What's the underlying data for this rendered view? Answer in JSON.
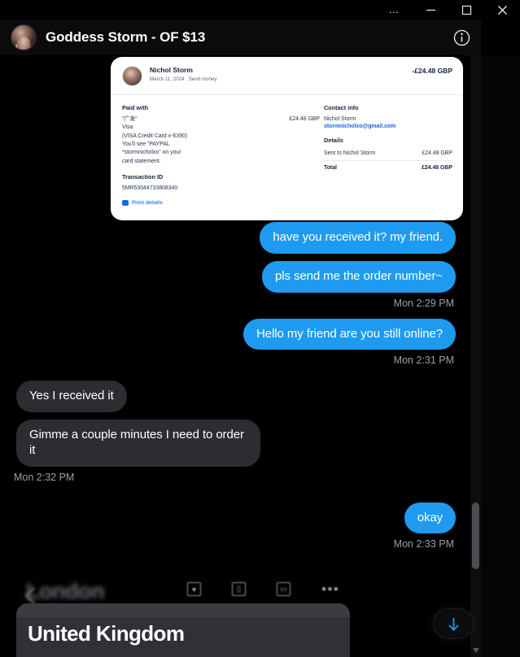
{
  "window": {
    "controls": [
      {
        "name": "more-options",
        "glyph": "…"
      },
      {
        "name": "minimize",
        "glyph": "—"
      },
      {
        "name": "maximize",
        "glyph": "□"
      },
      {
        "name": "close",
        "glyph": "✕"
      }
    ]
  },
  "header": {
    "title": "Goddess Storm - OF $13",
    "avatar_name": "avatar",
    "info_icon": "info-icon"
  },
  "receipt": {
    "sender": "Nichol Storm",
    "subtitle": "March 11, 2024 . Send money",
    "amount": "-£24.48 GBP",
    "paid_with_heading": "Paid with",
    "paid_with_card_label": "\"广发\"",
    "paid_with_amount": "£24.48 GBP",
    "paid_with_lines": [
      "Visa",
      "(VISA Credit Card x-6390)",
      "You'll see \"PAYPAL",
      "*stormnicholxo\" on your",
      "card statement."
    ],
    "transaction_id_heading": "Transaction ID",
    "transaction_id": "5MR53044733808340",
    "contact_heading": "Contact info",
    "contact_name": "Nichol Storm",
    "contact_email": "stormnicholxo@gmail.com",
    "details_heading": "Details",
    "details_row_label": "Sent to Nichol Storm",
    "details_row_amount": "£24.48 GBP",
    "total_label": "Total",
    "total_amount": "£24.48 GBP",
    "footer_link": "Print details"
  },
  "conversation": [
    {
      "type": "outgoing",
      "text": "have you received it? my friend."
    },
    {
      "type": "outgoing",
      "text": "pls send me the order number~"
    },
    {
      "type": "stamp-out",
      "text": "Mon 2:29 PM"
    },
    {
      "type": "outgoing",
      "text": "Hello my friend are you still online?"
    },
    {
      "type": "stamp-out",
      "text": "Mon 2:31 PM"
    },
    {
      "type": "incoming",
      "text": "Yes I received it"
    },
    {
      "type": "incoming",
      "text": "Gimme a couple minutes I need to order it"
    },
    {
      "type": "stamp-in",
      "text": "Mon 2:32 PM"
    },
    {
      "type": "outgoing",
      "text": "okay"
    },
    {
      "type": "stamp-out",
      "text": "Mon 2:33 PM"
    }
  ],
  "bottom_overlay": {
    "background_title": "London",
    "card_title": "United Kingdom",
    "icons": [
      {
        "name": "save-heart-icon",
        "glyph": "♥"
      },
      {
        "name": "delete-trash-icon",
        "glyph": "▯"
      },
      {
        "name": "bookmark-icon",
        "glyph": "▭"
      },
      {
        "name": "overflow-menu-icon",
        "glyph": "•••"
      }
    ]
  },
  "fab": {
    "name": "scroll-to-bottom-button",
    "icon": "arrow-down-icon"
  },
  "colors": {
    "outgoing_bubble": "#1e9bf0",
    "incoming_bubble": "#2b2d31",
    "background": "#000000",
    "link": "#1668e3",
    "timestamp": "#9aa0a6"
  }
}
